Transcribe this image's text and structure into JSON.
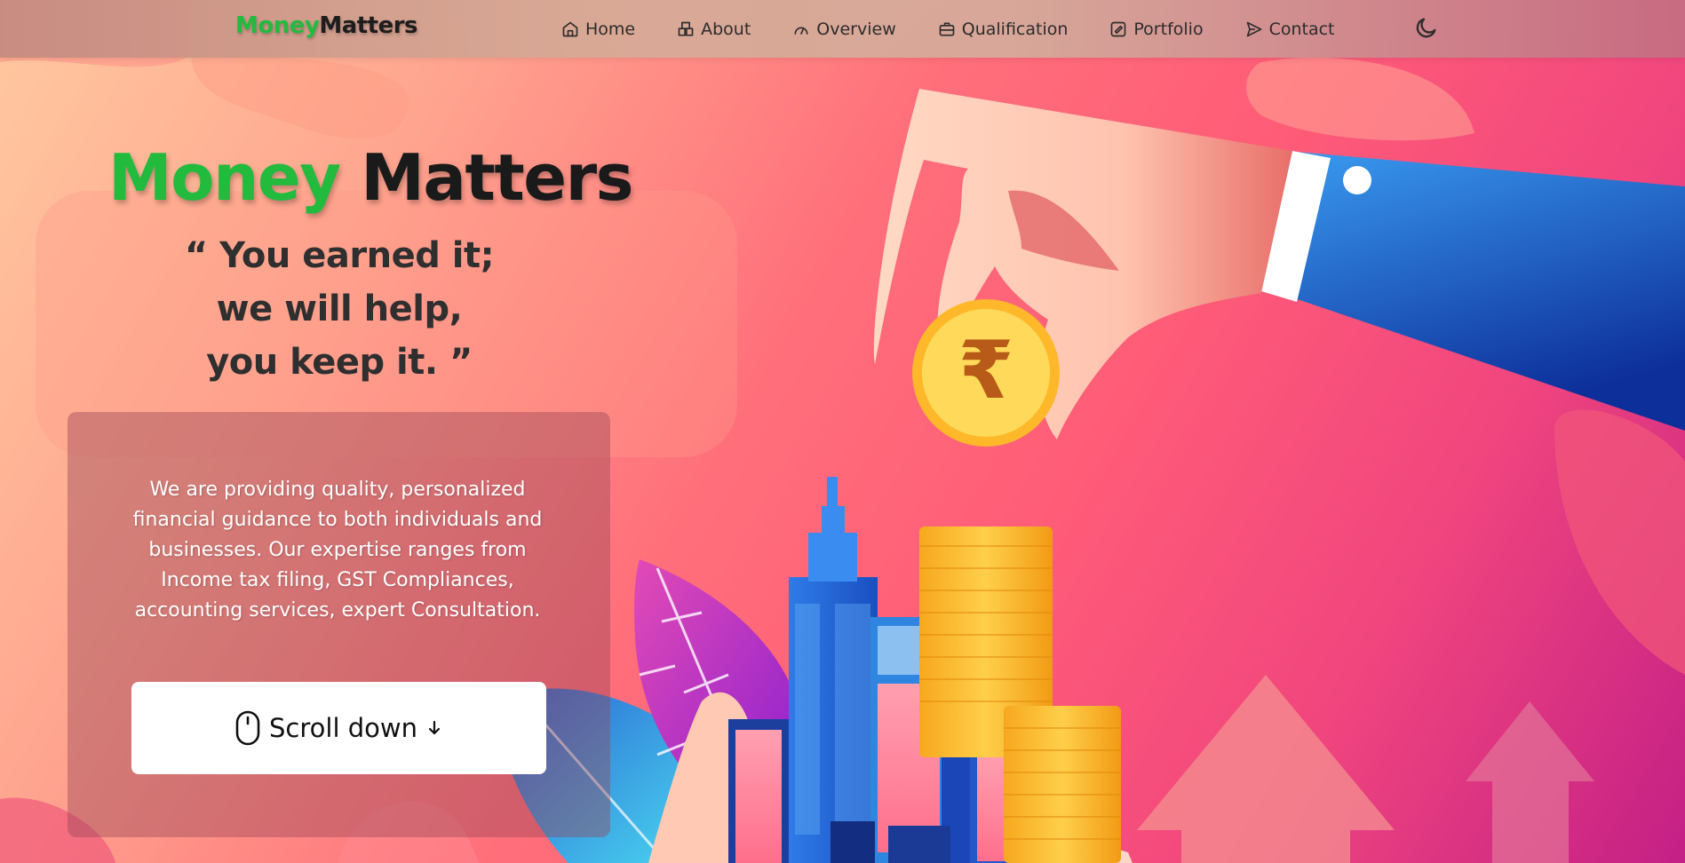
{
  "navbar": {
    "brand_part1": "Money",
    "brand_part2": "Matters",
    "links": [
      {
        "label": "Home",
        "icon": "home-icon"
      },
      {
        "label": "About",
        "icon": "cube-icon"
      },
      {
        "label": "Overview",
        "icon": "gauge-icon"
      },
      {
        "label": "Qualification",
        "icon": "briefcase-icon"
      },
      {
        "label": "Portfolio",
        "icon": "portfolio-icon"
      },
      {
        "label": "Contact",
        "icon": "send-icon"
      }
    ],
    "theme_icon": "moon-icon"
  },
  "hero": {
    "title_part1": "Money",
    "title_part2": "Matters",
    "quote_line1": "“ You earned it;",
    "quote_line2": "we will help,",
    "quote_line3": "you keep it. ”",
    "description": "We are providing quality, personalized financial guidance to both individuals and businesses. Our expertise ranges from Income tax filing, GST Compliances, accounting services, expert Consultation.",
    "scroll_label": "Scroll down",
    "coin_symbol": "₹"
  },
  "colors": {
    "brand_green": "#22bb3e",
    "text_dark": "#1a1a1a",
    "sleeve_blue": "#1f6fe0",
    "coin_yellow": "#ffd24a"
  }
}
